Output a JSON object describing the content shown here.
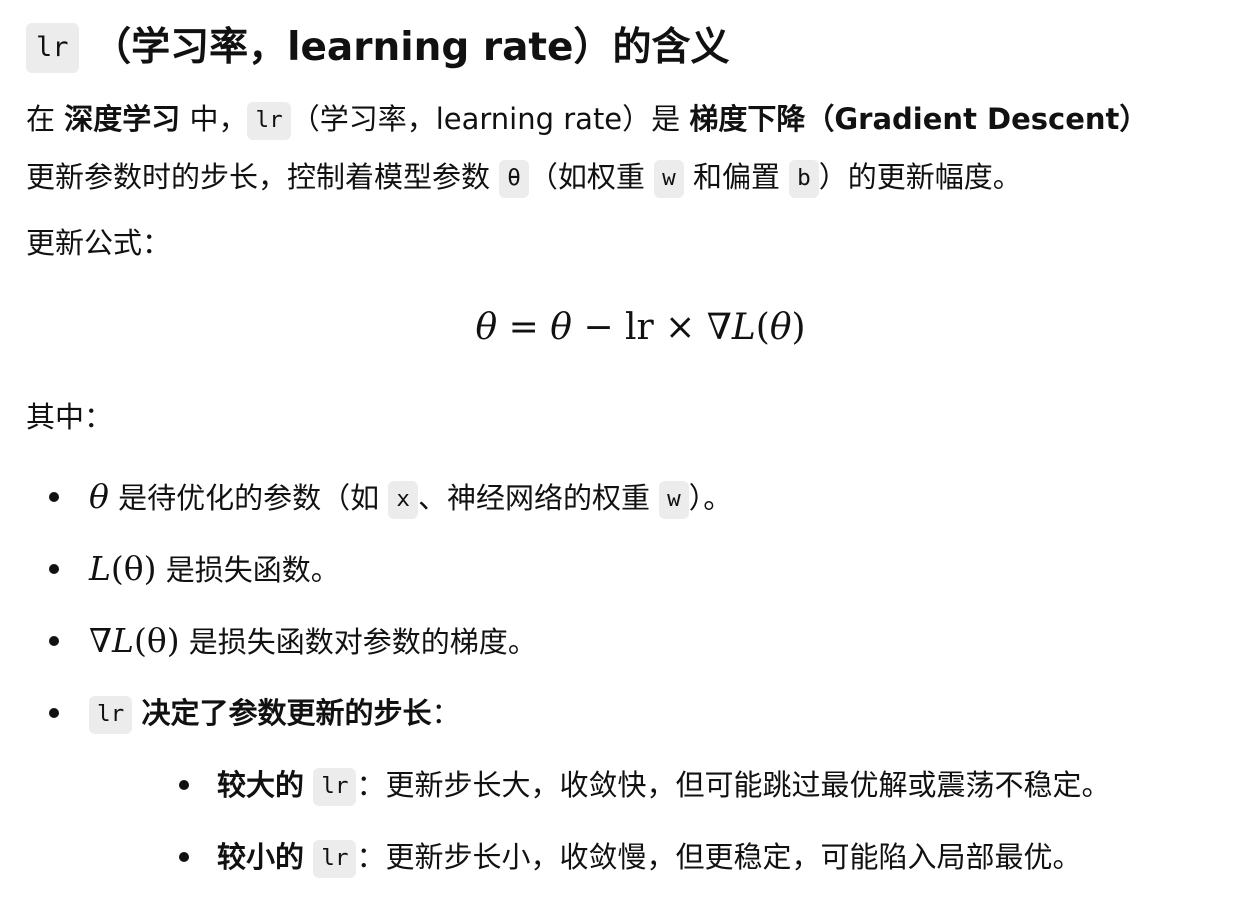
{
  "heading": {
    "code": "lr",
    "text": "（学习率，learning rate）的含义"
  },
  "intro": {
    "p1": "在",
    "bold1": "深度学习",
    "p2": "中，",
    "code1": "lr",
    "p3": "（学习率，learning rate）是",
    "bold2": "梯度下降（Gradient Descent）",
    "p4": "更新参数时的步长，控制着模型参数",
    "code2": "θ",
    "p5": "（如权重",
    "code3": "w",
    "p6": "和偏置",
    "code4": "b",
    "p7": "）的更新幅度。"
  },
  "formula_label": "更新公式：",
  "formula": {
    "theta1": "θ",
    "eq": " = ",
    "theta2": "θ",
    "minus": " − ",
    "lr": "lr",
    "times": " × ",
    "nabla": "∇",
    "L": "L",
    "paren": "(",
    "theta3": "θ",
    "close": ")"
  },
  "where_label": "其中：",
  "bullets": {
    "b1": {
      "math": "θ",
      "t1": " 是待优化的参数（如",
      "code1": "x",
      "t2": "、神经网络的权重",
      "code2": "w",
      "t3": "）。"
    },
    "b2": {
      "math_L": "L",
      "math_arg": "(θ)",
      "text": " 是损失函数。"
    },
    "b3": {
      "math_nabla": "∇",
      "math_L": "L",
      "math_arg": "(θ)",
      "text": " 是损失函数对参数的梯度。"
    },
    "b4": {
      "code": "lr",
      "bold": "决定了参数更新的步长",
      "colon": "：",
      "sub": [
        {
          "bold": "较大的",
          "code": "lr",
          "text": "：更新步长大，收敛快，但可能跳过最优解或震荡不稳定。"
        },
        {
          "bold": "较小的",
          "code": "lr",
          "text": "：更新步长小，收敛慢，但更稳定，可能陷入局部最优。"
        }
      ]
    }
  }
}
